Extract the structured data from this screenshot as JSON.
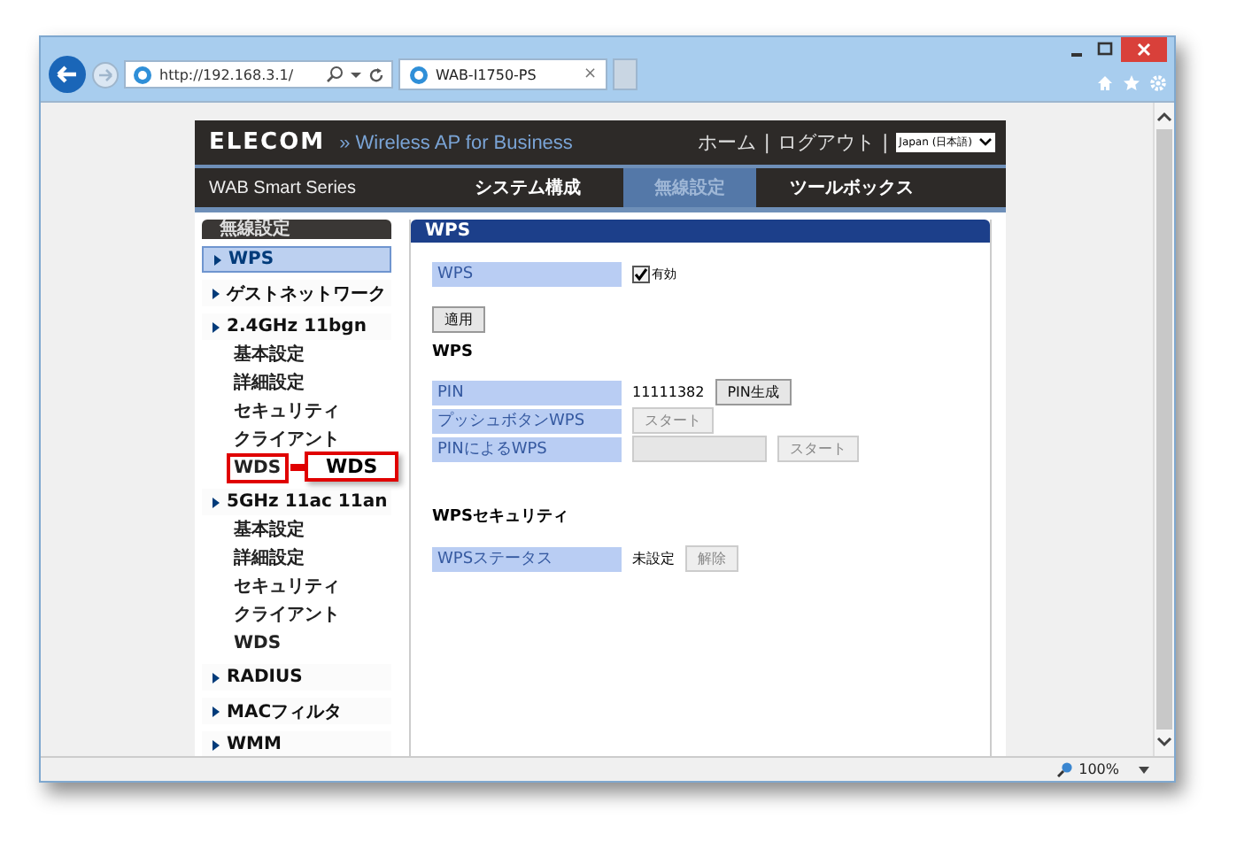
{
  "browser": {
    "address": "http://192.168.3.1/",
    "tab": {
      "title": "WAB-I1750-PS",
      "close": "×"
    },
    "zoom": "100%"
  },
  "header": {
    "logo": "ELECOM",
    "product": "» Wireless AP for Business",
    "links": [
      "ホーム",
      "ログアウト"
    ],
    "separator": "|",
    "language": "Japan (日本語)",
    "series": "WAB Smart Series"
  },
  "nav": [
    {
      "label": "システム構成",
      "selected": false
    },
    {
      "label": "無線設定",
      "selected": true
    },
    {
      "label": "ツールボックス",
      "selected": false
    }
  ],
  "sidebar": {
    "title": "無線設定",
    "items": [
      {
        "label": "WPS",
        "selected": true
      },
      {
        "label": "ゲストネットワーク",
        "selected": false
      },
      {
        "label": "2.4GHz 11bgn",
        "selected": false,
        "children": [
          {
            "label": "基本設定",
            "selected": false
          },
          {
            "label": "詳細設定",
            "selected": false
          },
          {
            "label": "セキュリティ",
            "selected": false
          },
          {
            "label": "クライアント",
            "selected": false
          },
          {
            "label": "WDS",
            "selected": false,
            "callout": "WDS"
          }
        ]
      },
      {
        "label": "5GHz 11ac 11an",
        "selected": false,
        "children": [
          {
            "label": "基本設定",
            "selected": false
          },
          {
            "label": "詳細設定",
            "selected": false
          },
          {
            "label": "セキュリティ",
            "selected": false
          },
          {
            "label": "クライアント",
            "selected": false
          },
          {
            "label": "WDS",
            "selected": false
          }
        ]
      },
      {
        "label": "RADIUS",
        "selected": false
      },
      {
        "label": "MACフィルタ",
        "selected": false
      },
      {
        "label": "WMM",
        "selected": false
      }
    ]
  },
  "panel": {
    "title": "WPS",
    "enable": {
      "label": "WPS",
      "option": "有効",
      "checked": true
    },
    "apply": "適用",
    "sections": [
      {
        "heading": "WPS",
        "rows": [
          {
            "kind": "value_button",
            "label": "PIN",
            "value": "11111382",
            "button": {
              "label": "PIN生成",
              "disabled": false
            }
          },
          {
            "kind": "button",
            "label": "プッシュボタンWPS",
            "button": {
              "label": "スタート",
              "disabled": true
            }
          },
          {
            "kind": "input_button",
            "label": "PINによるWPS",
            "disabled": true,
            "button": {
              "label": "スタート",
              "disabled": true
            }
          }
        ]
      },
      {
        "heading": "WPSセキュリティ",
        "rows": [
          {
            "kind": "value_button",
            "label": "WPSステータス",
            "value": "未設定",
            "button": {
              "label": "解除",
              "disabled": true
            }
          }
        ]
      }
    ]
  }
}
